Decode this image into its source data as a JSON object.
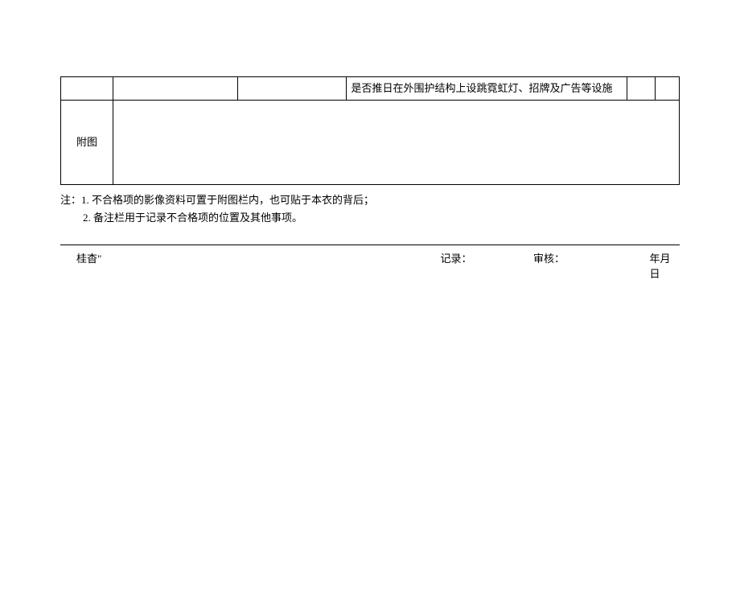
{
  "table": {
    "row1": {
      "col1": "",
      "col2": "",
      "col3": "",
      "col4": "是否推日在外围护结构上设跳霓虹灯、招牌及广告等设施",
      "col5": "",
      "col6": ""
    },
    "row2": {
      "label": "附图",
      "content": ""
    }
  },
  "notes": {
    "line1": "注：1. 不合格项的影像资料可置于附图栏内，也可贴于本衣的背后；",
    "line2": "2. 备注栏用于记录不合格项的位置及其他事项。"
  },
  "signatures": {
    "inspect": "桂杳\"",
    "record": "记录：",
    "review": "审核：",
    "date": "年月日"
  }
}
